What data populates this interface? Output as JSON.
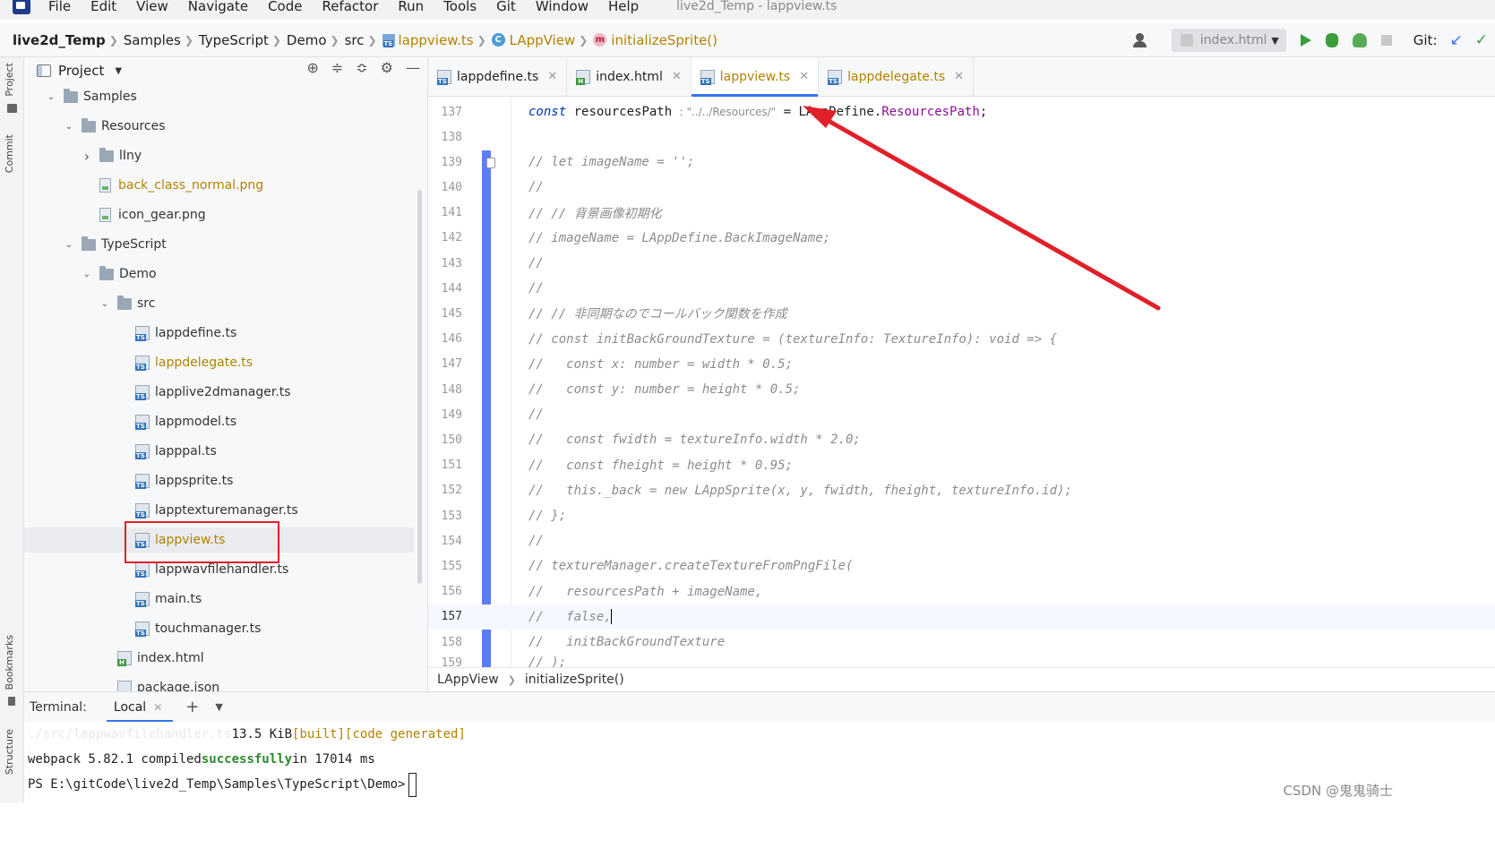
{
  "menu": {
    "items": [
      "File",
      "Edit",
      "View",
      "Navigate",
      "Code",
      "Refactor",
      "Run",
      "Tools",
      "Git",
      "Window",
      "Help"
    ],
    "window_title": "live2d_Temp - lappview.ts"
  },
  "navbar": {
    "crumbs": [
      "live2d_Temp",
      "Samples",
      "TypeScript",
      "Demo",
      "src",
      "lappview.ts",
      "LAppView",
      "initializeSprite()"
    ],
    "run_config": "index.html",
    "git_label": "Git:"
  },
  "left_strip": {
    "project_tab": "Project",
    "commit_tab": "Commit",
    "bookmarks_tab": "Bookmarks",
    "structure_tab": "Structure"
  },
  "project": {
    "title": "Project",
    "tree": [
      {
        "label": "Samples",
        "kind": "folder",
        "depth": 0,
        "expanded": true
      },
      {
        "label": "Resources",
        "kind": "folder",
        "depth": 1,
        "expanded": true
      },
      {
        "label": "lIny",
        "kind": "folder",
        "depth": 2,
        "expanded": false
      },
      {
        "label": "back_class_normal.png",
        "kind": "png",
        "depth": 2,
        "highlight": true
      },
      {
        "label": "icon_gear.png",
        "kind": "png",
        "depth": 2
      },
      {
        "label": "TypeScript",
        "kind": "folder",
        "depth": 1,
        "expanded": true
      },
      {
        "label": "Demo",
        "kind": "folder",
        "depth": 2,
        "expanded": true
      },
      {
        "label": "src",
        "kind": "folder",
        "depth": 3,
        "expanded": true
      },
      {
        "label": "lappdefine.ts",
        "kind": "ts",
        "depth": 4
      },
      {
        "label": "lappdelegate.ts",
        "kind": "ts",
        "depth": 4,
        "highlight": true
      },
      {
        "label": "lapplive2dmanager.ts",
        "kind": "ts",
        "depth": 4
      },
      {
        "label": "lappmodel.ts",
        "kind": "ts",
        "depth": 4
      },
      {
        "label": "lapppal.ts",
        "kind": "ts",
        "depth": 4
      },
      {
        "label": "lappsprite.ts",
        "kind": "ts",
        "depth": 4
      },
      {
        "label": "lapptexturemanager.ts",
        "kind": "ts",
        "depth": 4
      },
      {
        "label": "lappview.ts",
        "kind": "ts",
        "depth": 4,
        "highlight": true,
        "selected": true
      },
      {
        "label": "lappwavfilehandler.ts",
        "kind": "ts",
        "depth": 4
      },
      {
        "label": "main.ts",
        "kind": "ts",
        "depth": 4
      },
      {
        "label": "touchmanager.ts",
        "kind": "ts",
        "depth": 4
      },
      {
        "label": "index.html",
        "kind": "html",
        "depth": 3
      },
      {
        "label": "package.json",
        "kind": "json",
        "depth": 3
      }
    ]
  },
  "tabs": [
    {
      "label": "lappdefine.ts",
      "kind": "ts",
      "active": false
    },
    {
      "label": "index.html",
      "kind": "html",
      "active": false
    },
    {
      "label": "lappview.ts",
      "kind": "ts",
      "active": true
    },
    {
      "label": "lappdelegate.ts",
      "kind": "ts",
      "active": false
    }
  ],
  "editor": {
    "current_line": 157,
    "line137": {
      "keyword": "const",
      "name": " resourcesPath",
      "hint": ": \"../../Resources/\"",
      "rest": " = LAppDefine.",
      "prop": "ResourcesPath",
      "end": ";"
    },
    "lines": [
      {
        "n": 138,
        "text": ""
      },
      {
        "n": 139,
        "text": "// let imageName = '';"
      },
      {
        "n": 140,
        "text": "//"
      },
      {
        "n": 141,
        "text": "// // 背景画像初期化"
      },
      {
        "n": 142,
        "text": "// imageName = LAppDefine.BackImageName;"
      },
      {
        "n": 143,
        "text": "//"
      },
      {
        "n": 144,
        "text": "//"
      },
      {
        "n": 145,
        "text": "// // 非同期なのでコールバック関数を作成"
      },
      {
        "n": 146,
        "text": "// const initBackGroundTexture = (textureInfo: TextureInfo): void => {"
      },
      {
        "n": 147,
        "text": "//   const x: number = width * 0.5;"
      },
      {
        "n": 148,
        "text": "//   const y: number = height * 0.5;"
      },
      {
        "n": 149,
        "text": "//"
      },
      {
        "n": 150,
        "text": "//   const fwidth = textureInfo.width * 2.0;"
      },
      {
        "n": 151,
        "text": "//   const fheight = height * 0.95;"
      },
      {
        "n": 152,
        "text": "//   this._back = new LAppSprite(x, y, fwidth, fheight, textureInfo.id);"
      },
      {
        "n": 153,
        "text": "// };"
      },
      {
        "n": 154,
        "text": "//"
      },
      {
        "n": 155,
        "text": "// textureManager.createTextureFromPngFile("
      },
      {
        "n": 156,
        "text": "//   resourcesPath + imageName,"
      },
      {
        "n": 157,
        "text": "//   false,"
      },
      {
        "n": 158,
        "text": "//   initBackGroundTexture"
      }
    ],
    "partial_line_number": "159",
    "partial_line_text": "// );"
  },
  "editor_crumbs": [
    "LAppView",
    "initializeSprite()"
  ],
  "terminal": {
    "title": "Terminal:",
    "tab": "Local",
    "line1_faded": "./src/lappwavfilehandler.ts",
    "line1_size": "13.5 KiB",
    "line1_built": "[built]",
    "line1_generated": "[code generated]",
    "line2_prefix": "webpack 5.82.1 compiled",
    "line2_success": "successfully",
    "line2_suffix": "in 17014 ms",
    "prompt": "PS E:\\gitCode\\live2d_Temp\\Samples\\TypeScript\\Demo>"
  },
  "watermark": "CSDN @鬼鬼骑士",
  "colors": {
    "accent": "#3574f0",
    "highlight_file": "#b38200",
    "annotation_red": "#e0202a",
    "change_marker": "#5c7df5"
  }
}
